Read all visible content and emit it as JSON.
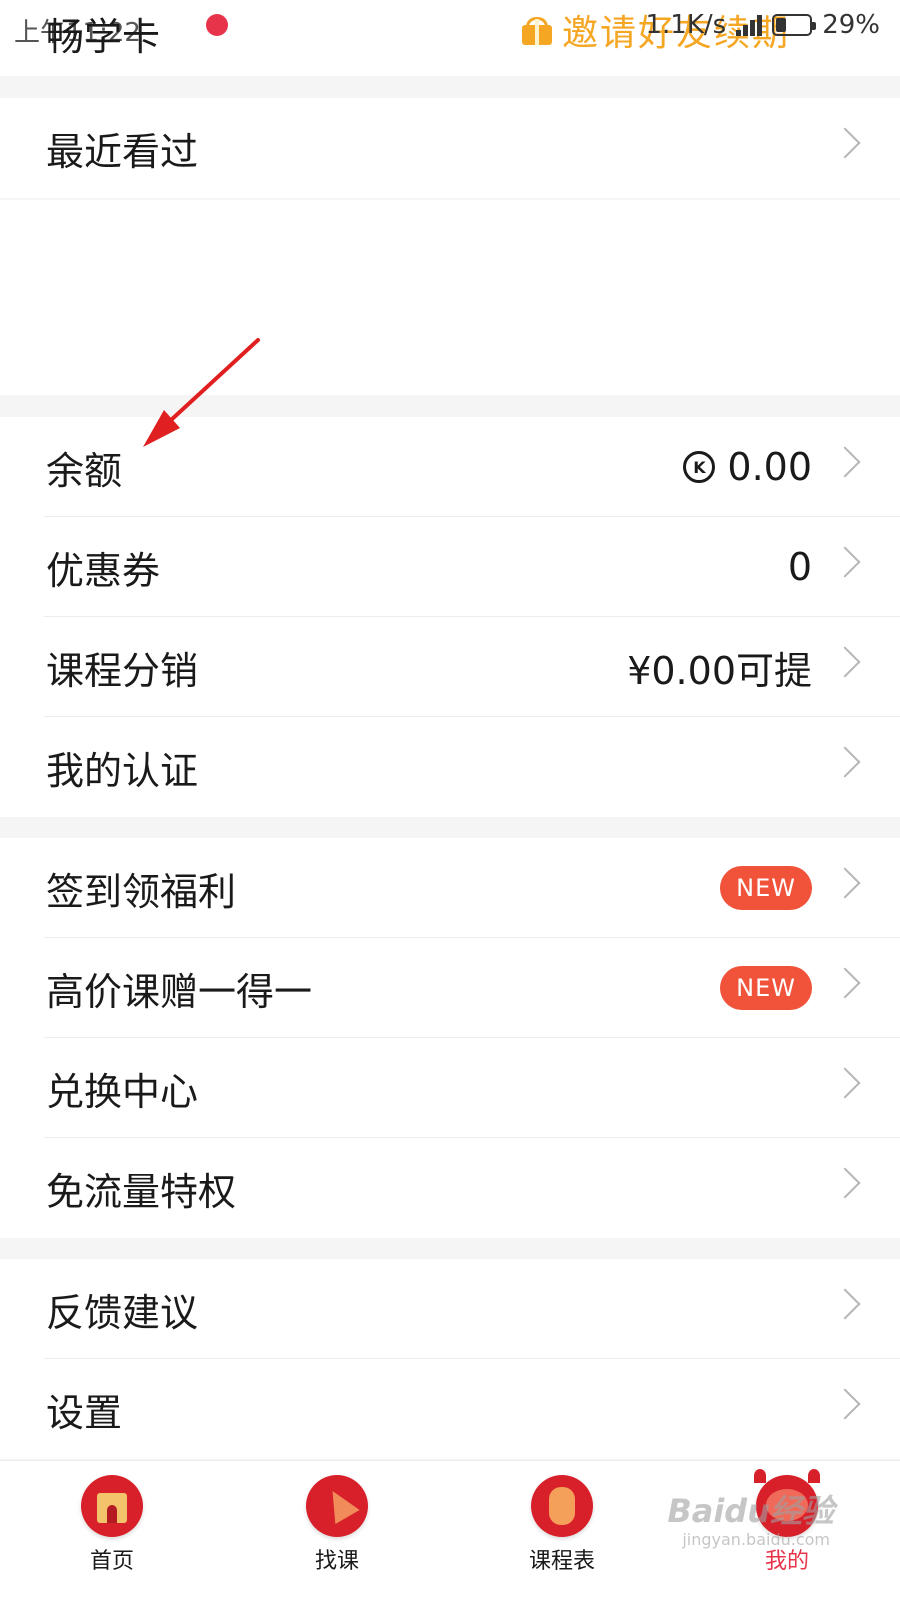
{
  "status_bar": {
    "time": "上午11:22",
    "network_speed": "1.1K/s",
    "battery": "29%"
  },
  "header": {
    "title": "畅学卡",
    "promo_text": "邀请好友续期"
  },
  "group1": {
    "recent_label": "最近看过"
  },
  "group2": {
    "balance_label": "余额",
    "balance_value": "0.00",
    "coin_glyph": "K",
    "coupon_label": "优惠券",
    "coupon_value": "0",
    "distribution_label": "课程分销",
    "distribution_value": "¥0.00可提",
    "certification_label": "我的认证"
  },
  "group3": {
    "checkin_label": "签到领福利",
    "checkin_badge": "NEW",
    "buy_one_label": "高价课赠一得一",
    "buy_one_badge": "NEW",
    "exchange_label": "兑换中心",
    "free_data_label": "免流量特权"
  },
  "group4": {
    "feedback_label": "反馈建议",
    "settings_label": "设置"
  },
  "bottom_nav": {
    "home": "首页",
    "find": "找课",
    "schedule": "课程表",
    "mine": "我的"
  },
  "watermark": {
    "main": "Baidu经验",
    "sub": "jingyan.baidu.com"
  },
  "colors": {
    "accent_red": "#e8344a",
    "badge_red": "#f0523a",
    "promo_orange": "#f5a623",
    "annotation_arrow": "#e02020"
  }
}
